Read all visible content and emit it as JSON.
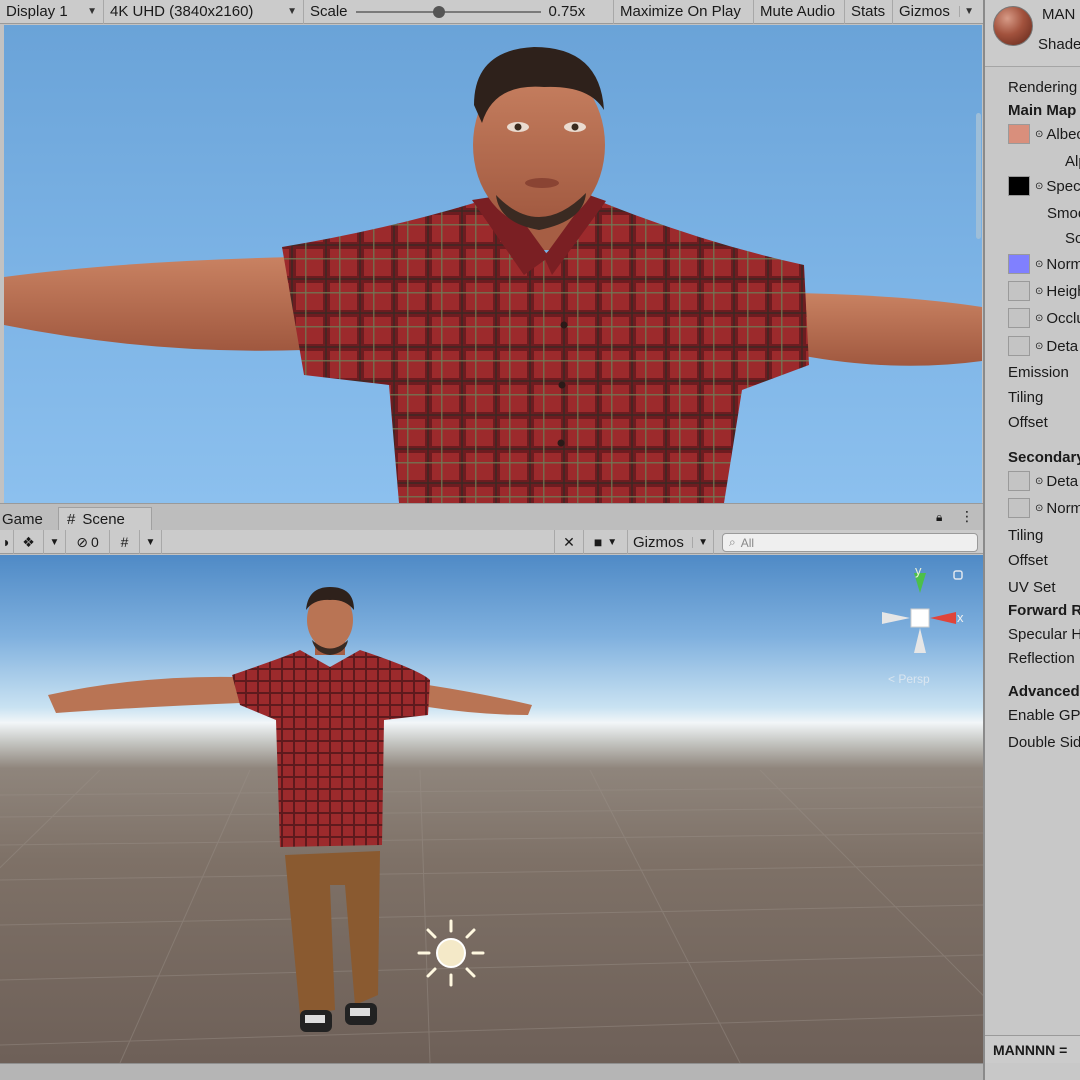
{
  "game_toolbar": {
    "display": "Display 1",
    "resolution": "4K UHD (3840x2160)",
    "scale_label": "Scale",
    "scale_value": "0.75x",
    "scale_fraction": 0.45,
    "maximize": "Maximize On Play",
    "mute": "Mute Audio",
    "stats": "Stats",
    "gizmos": "Gizmos"
  },
  "scene_tabs": {
    "game": "Game",
    "scene": "Scene"
  },
  "scene_toolbar": {
    "hidden_count": "0",
    "gizmos": "Gizmos",
    "search_placeholder": "All"
  },
  "orientation_gizmo": {
    "y": "y",
    "x": "x",
    "projection": "Persp"
  },
  "inspector": {
    "material_name": "MAN",
    "shader": "Shade",
    "rendering": "Rendering",
    "main_maps": "Main Map",
    "albedo": "Albec",
    "alpha": "Alp",
    "specular": "Spec",
    "smoothness": "Smoo",
    "source": "Sc",
    "normal": "Norm",
    "height": "Heigh",
    "occlusion": "Occlu",
    "detail_mask": "Deta",
    "emission": "Emission",
    "tiling": "Tiling",
    "offset": "Offset",
    "secondary": "Secondary",
    "detail_albedo": "Deta",
    "detail_normal": "Norm",
    "tiling2": "Tiling",
    "offset2": "Offset",
    "uv_set": "UV Set",
    "forward": "Forward R",
    "specular_highlights": "Specular H",
    "reflections": "Reflection",
    "advanced": "Advanced",
    "gpu_instancing": "Enable GP",
    "double_sided": "Double Sid",
    "footer": "MANNNN ="
  },
  "colors": {
    "albedo_swatch": "#d98f7c",
    "specular_swatch": "#000000",
    "normal_swatch": "#8080ff",
    "sky": "#7db4e6",
    "shirt": "#9c2a2c",
    "skin": "#b87052"
  }
}
